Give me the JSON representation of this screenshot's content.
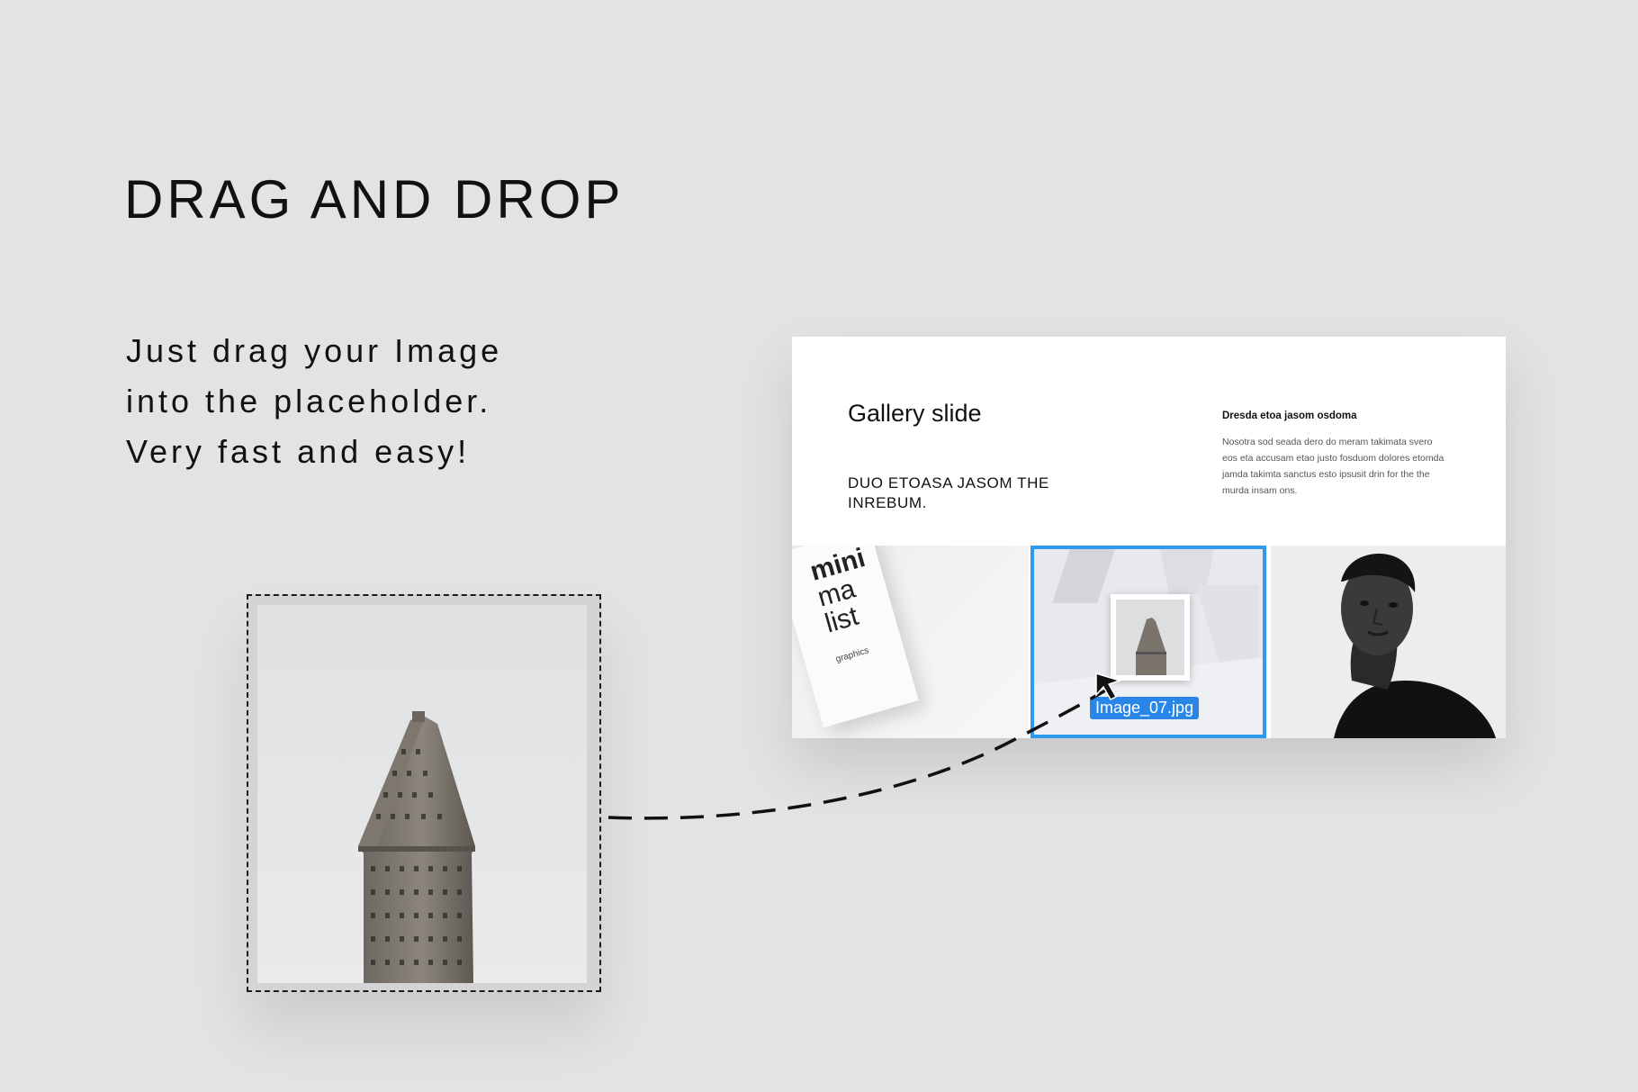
{
  "heading": "DRAG AND DROP",
  "description": {
    "lines": [
      "Just drag your Image",
      "into the placeholder.",
      "Very fast and easy!"
    ]
  },
  "slide": {
    "title": "Gallery slide",
    "subtitle": "DUO ETOASA JASOM THE INREBUM.",
    "side_title": "Dresda etoa jasom osdoma",
    "side_body": "Nosotra sod seada dero do meram takimata svero eos eta accusam etao justo fosduom dolores etomda jamda takimta sanctus esto ipsusit drin for the the murda insam ons.",
    "book_cover": {
      "word1": "mini",
      "word2": "ma",
      "word3": "list",
      "small": "graphics"
    },
    "file_label": "Image_07.jpg"
  },
  "colors": {
    "background": "#e3e3e5",
    "selection_accent": "#2f9bf0",
    "file_label_bg": "#2a86e6"
  },
  "icons": {
    "drag_path": "dashed-curve-arrow",
    "cursor": "arrow-cursor-icon"
  }
}
